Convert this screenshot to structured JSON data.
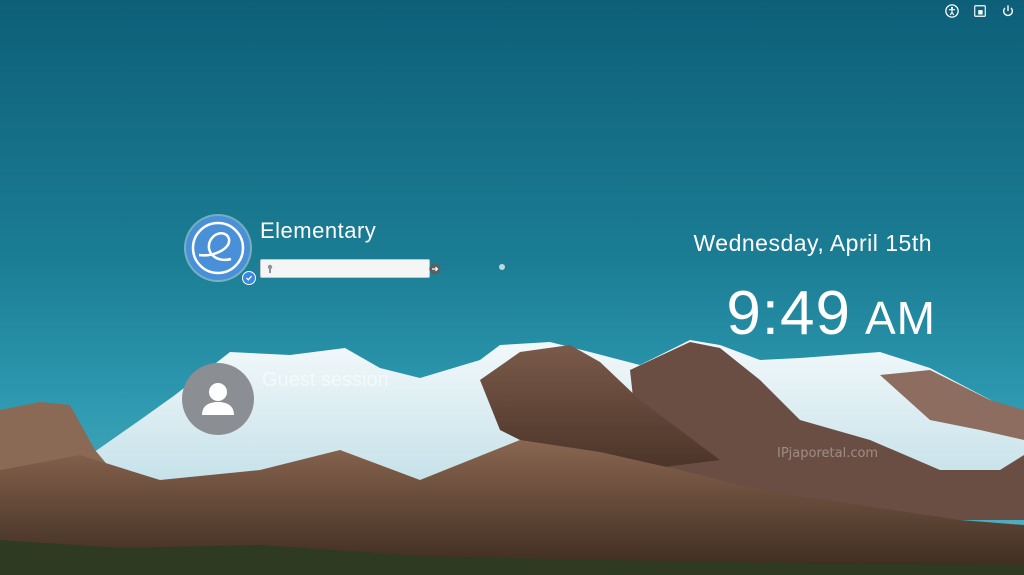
{
  "tray": {
    "accessibility_icon": "accessibility-icon",
    "keyboard_icon": "keyboard-layout-icon",
    "power_icon": "power-icon"
  },
  "users": {
    "main": {
      "name": "Elementary",
      "avatar_icon": "elementary-logo-icon",
      "password_placeholder": "",
      "password_value": ""
    },
    "guest": {
      "name": "Guest session",
      "avatar_icon": "person-icon"
    }
  },
  "clock": {
    "date": "Wednesday, April 15th",
    "time": "9:49",
    "ampm": "AM"
  },
  "watermark": "IPjaporetal.com",
  "colors": {
    "sky_top": "#0d5f78",
    "accent_blue": "#4a90d9",
    "guest_avatar": "#8b8f93"
  }
}
